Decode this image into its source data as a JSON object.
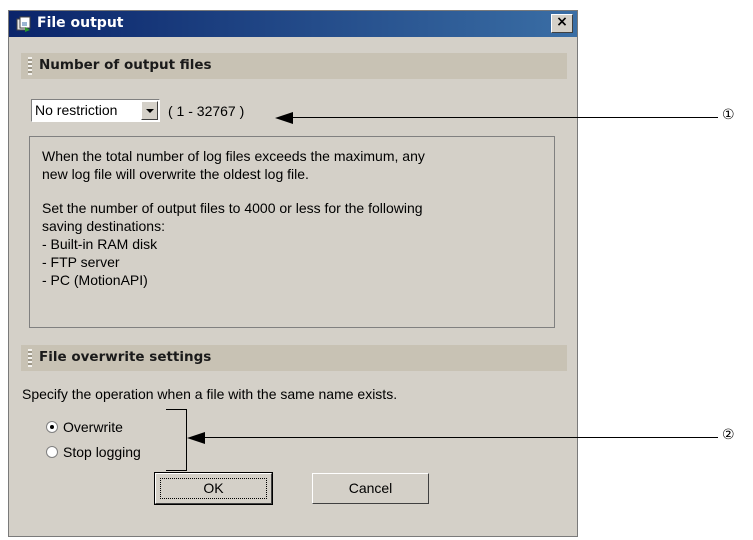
{
  "window": {
    "title": "File output",
    "close_glyph": "×"
  },
  "output_files": {
    "header": "Number of output files",
    "count_value": "No restriction",
    "range": "( 1 - 32767 )",
    "info": {
      "line1": "When the total number of log files exceeds the maximum, any",
      "line2": "new log file will overwrite the oldest log file.",
      "line3": "Set the number of output files to 4000 or less for the following",
      "line4": "saving destinations:",
      "item1": "- Built-in RAM disk",
      "item2": "- FTP server",
      "item3": "- PC (MotionAPI)"
    }
  },
  "overwrite": {
    "header": "File overwrite settings",
    "description": "Specify the operation when a file with the same name exists.",
    "options": [
      {
        "label": "Overwrite",
        "selected": true
      },
      {
        "label": "Stop logging",
        "selected": false
      }
    ]
  },
  "buttons": {
    "ok": "OK",
    "cancel": "Cancel"
  },
  "callouts": {
    "one": "①",
    "two": "②"
  }
}
